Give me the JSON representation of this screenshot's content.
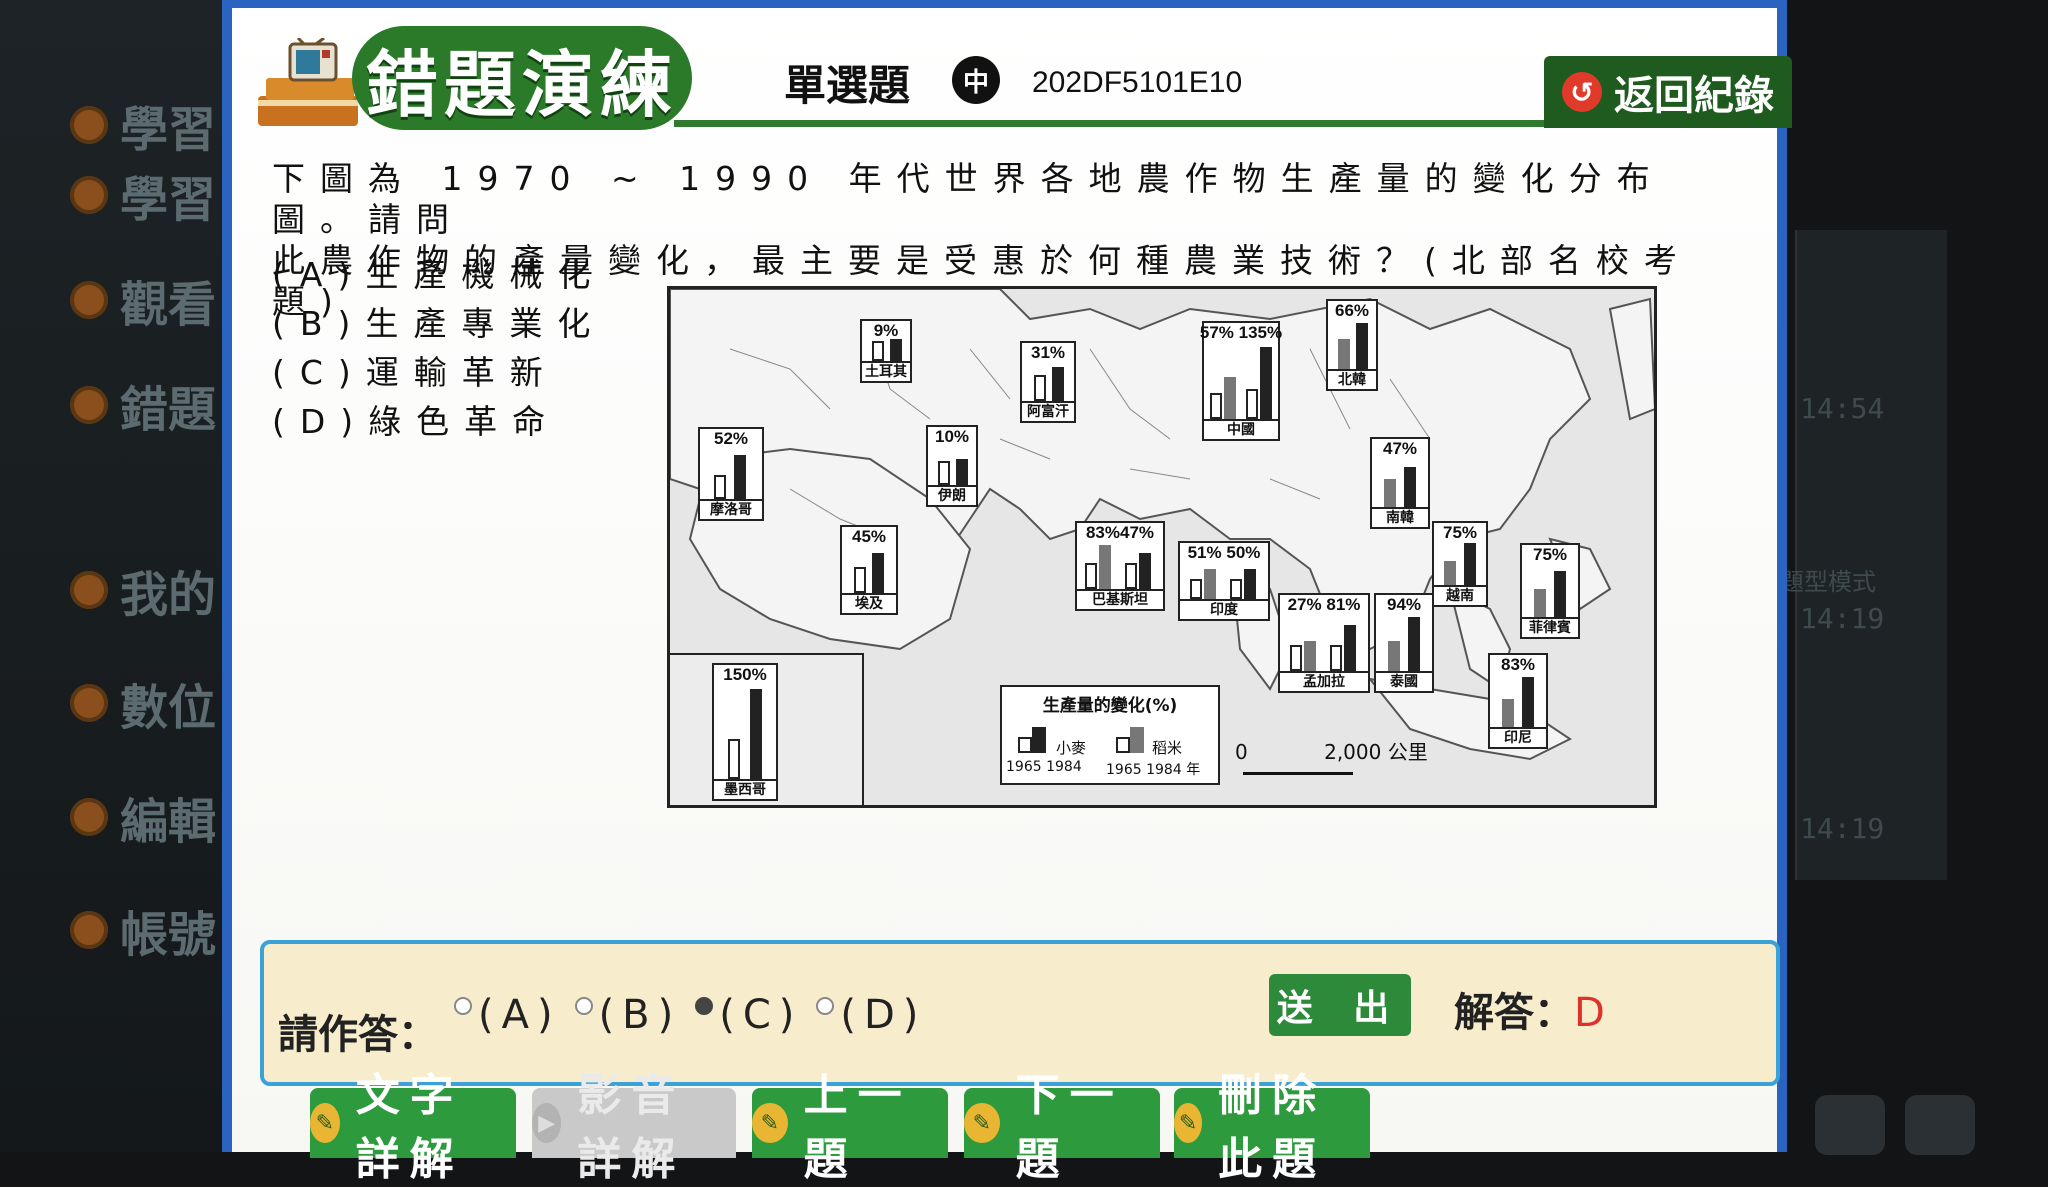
{
  "background": {
    "sidebar_items": [
      {
        "label": "學習",
        "active": false
      },
      {
        "label": "學習",
        "active": false
      },
      {
        "label": "觀看",
        "active": false
      },
      {
        "label": "錯題",
        "active": true
      },
      {
        "label": "我的",
        "active": false
      },
      {
        "label": "數位",
        "active": false
      },
      {
        "label": "編輯",
        "active": false
      },
      {
        "label": "帳號",
        "active": false
      }
    ],
    "right_times": [
      "14:54",
      "14:19",
      "14:19"
    ],
    "right_mode": "題型模式"
  },
  "header": {
    "title": "錯題演練",
    "question_type": "單選題",
    "level": "中",
    "code": "202DF5101E10",
    "back_label": "返回紀錄"
  },
  "question": {
    "line1": "下圖為 1970 ~ 1990 年代世界各地農作物生產量的變化分布圖。請問",
    "line2": "此農作物的產量變化，最主要是受惠於何種農業技術？(北部名校考題)",
    "options": [
      "(A)生產機械化",
      "(B)生產專業化",
      "(C)運輸革新",
      "(D)綠色革命"
    ]
  },
  "map": {
    "countries": [
      {
        "name": "土耳其",
        "pct": "9%"
      },
      {
        "name": "阿富汗",
        "pct": "31%"
      },
      {
        "name": "中國",
        "pct_a": "57%",
        "pct_b": "135%"
      },
      {
        "name": "北韓",
        "pct": "66%"
      },
      {
        "name": "摩洛哥",
        "pct": "52%"
      },
      {
        "name": "伊朗",
        "pct": "10%"
      },
      {
        "name": "南韓",
        "pct": "47%"
      },
      {
        "name": "埃及",
        "pct": "45%"
      },
      {
        "name": "巴基斯坦",
        "pct_a": "83%",
        "pct_b": "47%"
      },
      {
        "name": "印度",
        "pct_a": "51%",
        "pct_b": "50%"
      },
      {
        "name": "越南",
        "pct": "75%"
      },
      {
        "name": "菲律賓",
        "pct": "75%"
      },
      {
        "name": "孟加拉",
        "pct_a": "27%",
        "pct_b": "81%"
      },
      {
        "name": "泰國",
        "pct": "94%"
      },
      {
        "name": "印尼",
        "pct": "83%"
      },
      {
        "name": "墨西哥",
        "pct": "150%"
      }
    ],
    "legend": {
      "title": "生產量的變化(%)",
      "wheat": "小麥",
      "rice": "稻米",
      "y1": "1965",
      "y2": "1984",
      "y3": "1965",
      "y4": "1984",
      "year_unit": "年"
    },
    "scale": {
      "zero": "0",
      "label": "2,000 公里"
    }
  },
  "answer": {
    "prompt": "請作答：",
    "options": [
      "(A)",
      "(B)",
      "(C)",
      "(D)"
    ],
    "selected": "(C)",
    "submit_label": "送 出",
    "solution_label": "解答：",
    "solution_value": "D"
  },
  "buttons": {
    "text_detail": "文字詳解",
    "video_detail": "影音詳解",
    "prev": "上一題",
    "next": "下一題",
    "delete": "刪除此題"
  }
}
